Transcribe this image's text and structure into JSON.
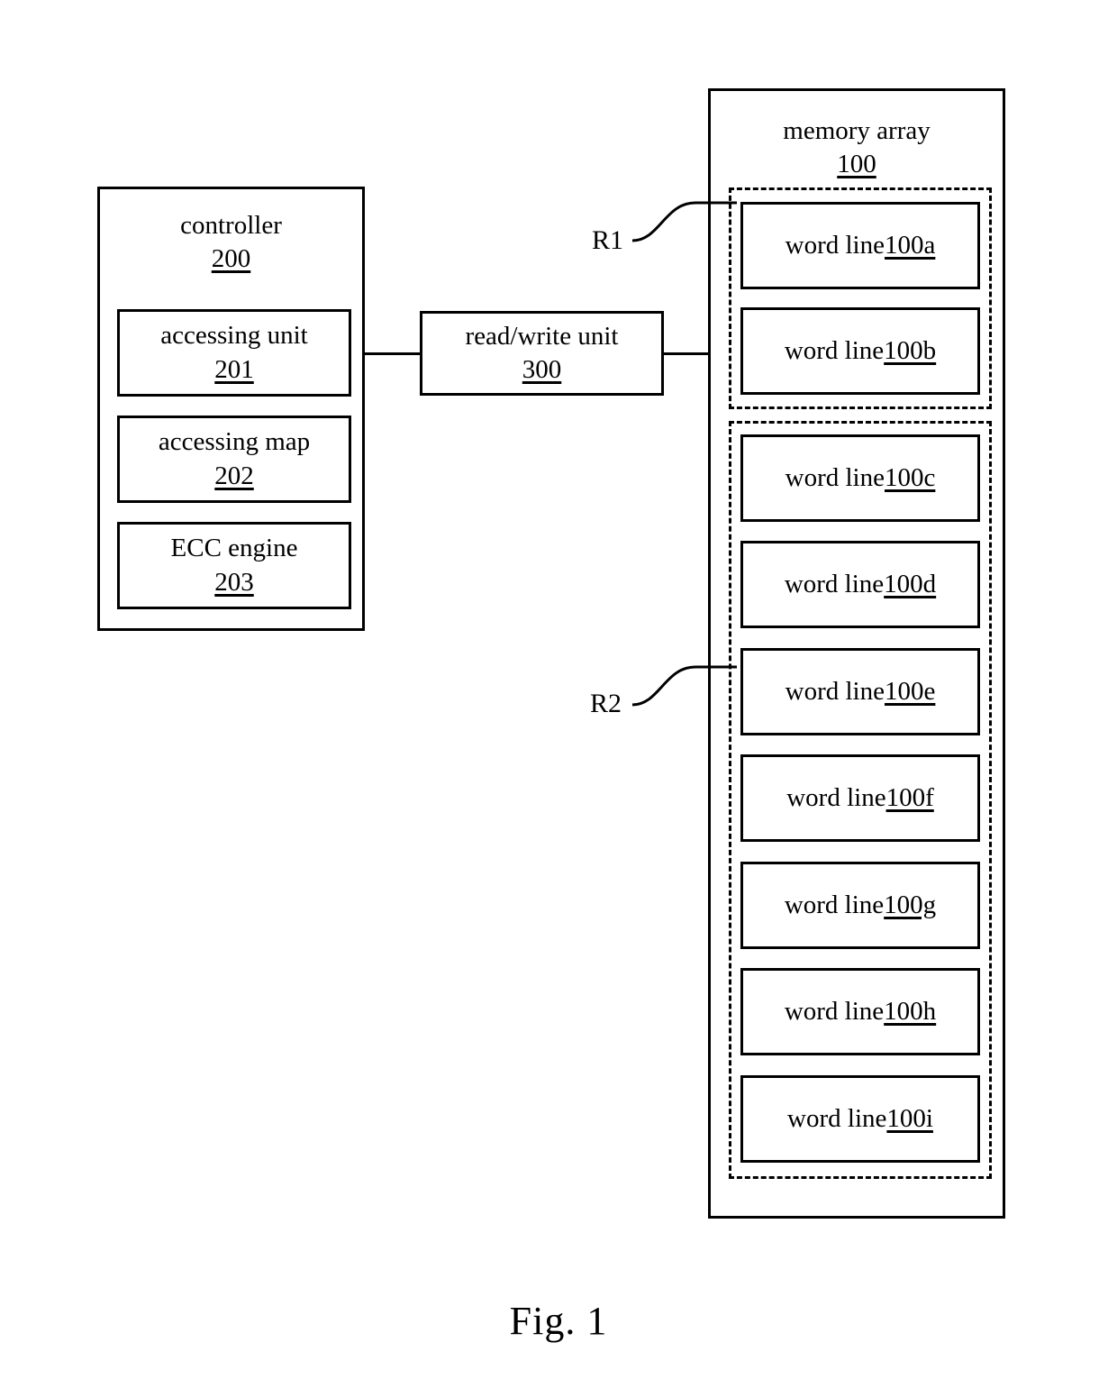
{
  "figure": {
    "caption": "Fig. 1"
  },
  "controller": {
    "title": "controller",
    "ref": "200",
    "units": [
      {
        "title": "accessing unit",
        "ref": "201"
      },
      {
        "title": "accessing map",
        "ref": "202"
      },
      {
        "title": "ECC engine",
        "ref": "203"
      }
    ]
  },
  "read_write_unit": {
    "title": "read/write unit",
    "ref": "300"
  },
  "memory_array": {
    "title": "memory array",
    "ref": "100",
    "regions": [
      {
        "label": "R1",
        "word_lines": [
          {
            "text": "word line ",
            "ref": "100a"
          },
          {
            "text": "word line ",
            "ref": "100b"
          }
        ]
      },
      {
        "label": "R2",
        "word_lines": [
          {
            "text": "word line ",
            "ref": "100c"
          },
          {
            "text": "word line ",
            "ref": "100d"
          },
          {
            "text": "word line ",
            "ref": "100e"
          },
          {
            "text": "word line ",
            "ref": "100f"
          },
          {
            "text": "word line ",
            "ref": "100g"
          },
          {
            "text": "word line ",
            "ref": "100h"
          },
          {
            "text": "word line ",
            "ref": "100i"
          }
        ]
      }
    ]
  },
  "colors": {
    "stroke": "#000000",
    "background": "#ffffff"
  }
}
